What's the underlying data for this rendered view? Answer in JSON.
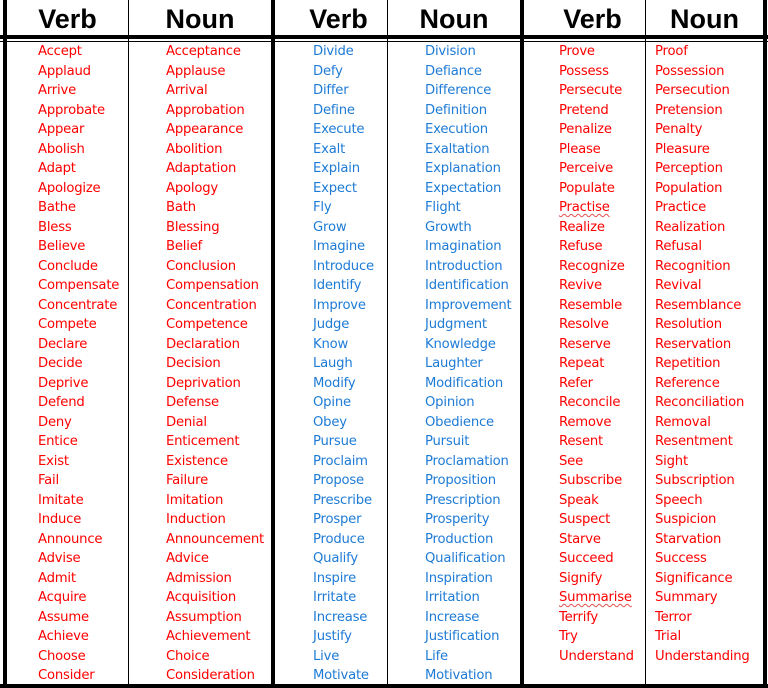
{
  "colors": {
    "set1": "#ff0000",
    "set2": "#1e7bd6",
    "set3": "#ff0000"
  },
  "headers": {
    "verb": "Verb",
    "noun": "Noun"
  },
  "tables": [
    {
      "color": "red",
      "verbs": [
        "Accept",
        "Applaud",
        "Arrive",
        "Approbate",
        "Appear",
        "Abolish",
        "Adapt",
        "Apologize",
        "Bathe",
        "Bless",
        "Believe",
        "Conclude",
        "Compensate",
        "Concentrate",
        "Compete",
        "Declare",
        "Decide",
        "Deprive",
        "Defend",
        "Deny",
        "Entice",
        "Exist",
        "Fail",
        "Imitate",
        "Induce",
        "Announce",
        "Advise",
        "Admit",
        "Acquire",
        "Assume",
        "Achieve",
        "Choose",
        "Consider"
      ],
      "nouns": [
        "Acceptance",
        "Applause",
        "Arrival",
        "Approbation",
        "Appearance",
        "Abolition",
        "Adaptation",
        "Apology",
        "Bath",
        "Blessing",
        "Belief",
        "Conclusion",
        "Compensation",
        "Concentration",
        "Competence",
        "Declaration",
        "Decision",
        "Deprivation",
        "Defense",
        "Denial",
        "Enticement",
        "Existence",
        "Failure",
        "Imitation",
        "Induction",
        "Announcement",
        "Advice",
        "Admission",
        "Acquisition",
        "Assumption",
        "Achievement",
        "Choice",
        "Consideration"
      ]
    },
    {
      "color": "blue",
      "verbs": [
        "Divide",
        "Defy",
        "Differ",
        "Define",
        "Execute",
        "Exalt",
        "Explain",
        "Expect",
        "Fly",
        "Grow",
        "Imagine",
        "Introduce",
        "Identify",
        "Improve",
        "Judge",
        "Know",
        "Laugh",
        "Modify",
        "Opine",
        "Obey",
        "Pursue",
        "Proclaim",
        "Propose",
        "Prescribe",
        "Prosper",
        "Produce",
        "Qualify",
        "Inspire",
        "Irritate",
        "Increase",
        "Justify",
        "Live",
        "Motivate"
      ],
      "nouns": [
        "Division",
        "Defiance",
        "Difference",
        "Definition",
        "Execution",
        "Exaltation",
        "Explanation",
        "Expectation",
        "Flight",
        "Growth",
        "Imagination",
        "Introduction",
        "Identification",
        "Improvement",
        "Judgment",
        "Knowledge",
        "Laughter",
        "Modification",
        "Opinion",
        "Obedience",
        "Pursuit",
        "Proclamation",
        "Proposition",
        "Prescription",
        "Prosperity",
        "Production",
        "Qualification",
        "Inspiration",
        "Irritation",
        "Increase",
        "Justification",
        "Life",
        "Motivation"
      ]
    },
    {
      "color": "red",
      "verbs": [
        "Prove",
        "Possess",
        "Persecute",
        "Pretend",
        "Penalize",
        "Please",
        "Perceive",
        "Populate",
        "Practise",
        "Realize",
        "Refuse",
        "Recognize",
        "Revive",
        "Resemble",
        "Resolve",
        "Reserve",
        "Repeat",
        "Refer",
        "Reconcile",
        "Remove",
        "Resent",
        "See",
        "Subscribe",
        "Speak",
        "Suspect",
        "Starve",
        "Succeed",
        "Signify",
        "Summarise",
        "Terrify",
        "Try",
        "Understand"
      ],
      "nouns": [
        "Proof",
        "Possession",
        "Persecution",
        "Pretension",
        "Penalty",
        "Pleasure",
        "Perception",
        "Population",
        "Practice",
        "Realization",
        "Refusal",
        "Recognition",
        "Revival",
        "Resemblance",
        "Resolution",
        "Reservation",
        "Repetition",
        "Reference",
        "Reconciliation",
        "Removal",
        "Resentment",
        "Sight",
        "Subscription",
        "Speech",
        "Suspicion",
        "Starvation",
        "Success",
        "Significance",
        "Summary",
        "Terror",
        "Trial",
        "Understanding"
      ],
      "spellcheck_flagged": [
        "Practise",
        "Summarise"
      ]
    }
  ]
}
